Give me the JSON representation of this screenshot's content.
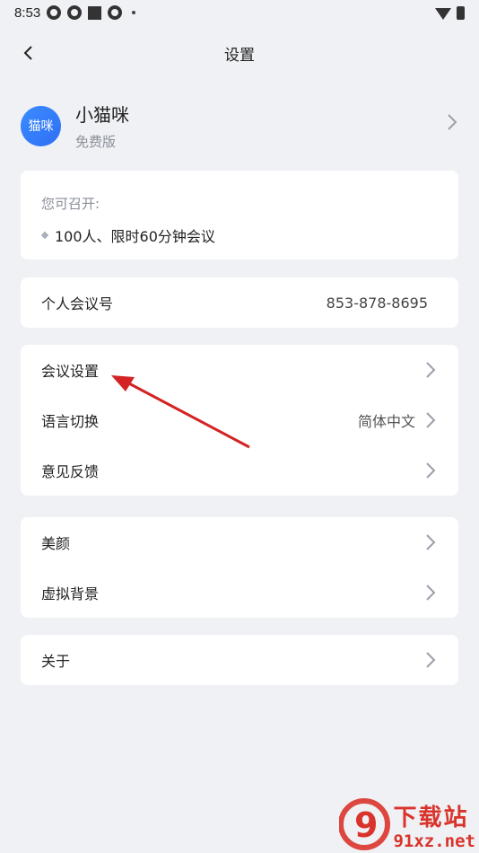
{
  "status_bar": {
    "time": "8:53"
  },
  "nav": {
    "title": "设置"
  },
  "profile": {
    "avatar_text": "猫咪",
    "name": "小猫咪",
    "plan": "免费版"
  },
  "meeting_info": {
    "label": "您可召开:",
    "item": "100人、限时60分钟会议"
  },
  "personal_meeting": {
    "label": "个人会议号",
    "value": "853-878-8695"
  },
  "group1": [
    {
      "label": "会议设置",
      "value": ""
    },
    {
      "label": "语言切换",
      "value": "简体中文"
    },
    {
      "label": "意见反馈",
      "value": ""
    }
  ],
  "group2": [
    {
      "label": "美颜"
    },
    {
      "label": "虚拟背景"
    }
  ],
  "about": {
    "label": "关于"
  },
  "watermark": {
    "main": "下载站",
    "sub": "91xz.net",
    "logo_text": "9"
  },
  "colors": {
    "background": "#f0f1f4",
    "accent": "#2f6ff5",
    "annotation": "#d32323"
  }
}
